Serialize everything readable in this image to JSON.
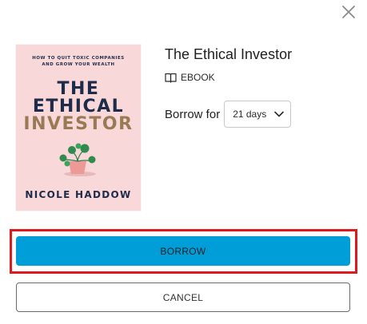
{
  "dialog": {
    "close_icon": "close-icon"
  },
  "cover": {
    "subtitle_line1": "HOW TO QUIT TOXIC COMPANIES",
    "subtitle_line2": "AND GROW YOUR WEALTH",
    "title_line1": "THE",
    "title_line2": "ETHICAL",
    "title_line3": "INVESTOR",
    "author": "NICOLE HADDOW",
    "background_color": "#f8d8d8",
    "title_color": "#1e2b4a",
    "accent_color": "#9a7a55"
  },
  "book": {
    "title": "The Ethical Investor",
    "format_icon": "open-book-icon",
    "format": "EBOOK"
  },
  "borrow": {
    "label": "Borrow for",
    "selected_period": "21 days",
    "dropdown_icon": "chevron-down-icon"
  },
  "actions": {
    "borrow_label": "BORROW",
    "cancel_label": "CANCEL",
    "borrow_color": "#009ed8",
    "highlight_color": "#e0191e"
  }
}
